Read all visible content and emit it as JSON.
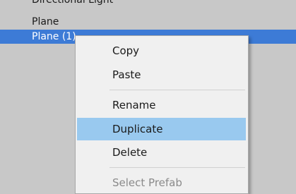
{
  "hierarchy": {
    "items": [
      {
        "label": "Directional Light"
      },
      {
        "label": "Plane"
      },
      {
        "label": "Plane (1)",
        "selected": true
      }
    ]
  },
  "context_menu": {
    "items": [
      {
        "label": "Copy"
      },
      {
        "label": "Paste"
      },
      {
        "label": "Rename"
      },
      {
        "label": "Duplicate",
        "highlighted": true
      },
      {
        "label": "Delete"
      },
      {
        "label": "Select Prefab",
        "disabled": true
      }
    ]
  },
  "colors": {
    "selection": "#3d7bd6",
    "menu_highlight": "#99c9ef",
    "panel_background": "#c8c8c8",
    "menu_background": "#f0f0f0"
  }
}
